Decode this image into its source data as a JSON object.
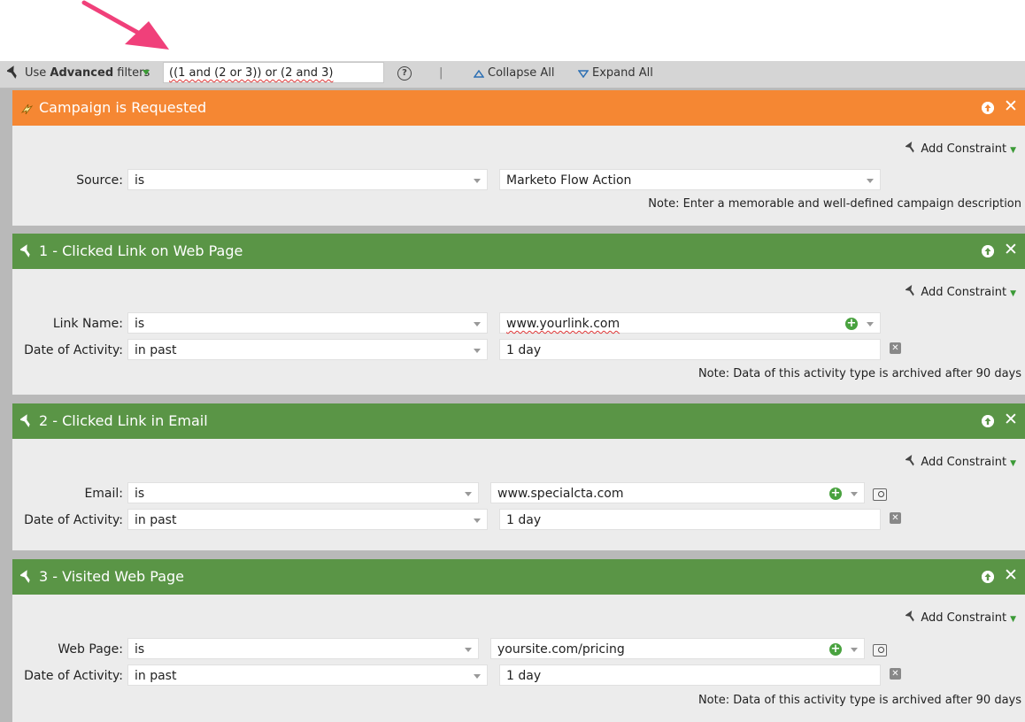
{
  "toolbar": {
    "use_prefix": "Use ",
    "use_bold": "Advanced",
    "use_suffix": " filters",
    "filter_logic": "((1 and (2 or 3)) or (2 and 3)",
    "help": "?",
    "separator": "|",
    "collapse_all": "Collapse All",
    "expand_all": "Expand All"
  },
  "add_constraint": "Add Constraint",
  "panels": [
    {
      "title": "Campaign is Requested",
      "header_color": "#f58733",
      "rows": [
        {
          "label": "Source:",
          "operator": "is",
          "value": "Marketo Flow Action"
        }
      ],
      "note": "Note: Enter a memorable and well-defined campaign description"
    },
    {
      "title": "1 - Clicked Link on Web Page",
      "header_color": "#5a9546",
      "rows": [
        {
          "label": "Link Name:",
          "operator": "is",
          "value": "www.yourlink.com"
        },
        {
          "label": "Date of Activity:",
          "operator": "in past",
          "value": "1 day"
        }
      ],
      "note": "Note: Data of this activity type is archived after 90 days"
    },
    {
      "title": "2 - Clicked Link in Email",
      "header_color": "#5a9546",
      "rows": [
        {
          "label": "Email:",
          "operator": "is",
          "value": "www.specialcta.com"
        },
        {
          "label": "Date of Activity:",
          "operator": "in past",
          "value": "1 day"
        }
      ]
    },
    {
      "title": "3 - Visited Web Page",
      "header_color": "#5a9546",
      "rows": [
        {
          "label": "Web Page:",
          "operator": "is",
          "value": "yoursite.com/pricing"
        },
        {
          "label": "Date of Activity:",
          "operator": "in past",
          "value": "1 day"
        }
      ],
      "note": "Note: Data of this activity type is archived after 90 days"
    }
  ],
  "colors": {
    "arrow": "#f0407a",
    "orange": "#f58733",
    "green": "#5a9546",
    "plus": "#49a23f"
  }
}
